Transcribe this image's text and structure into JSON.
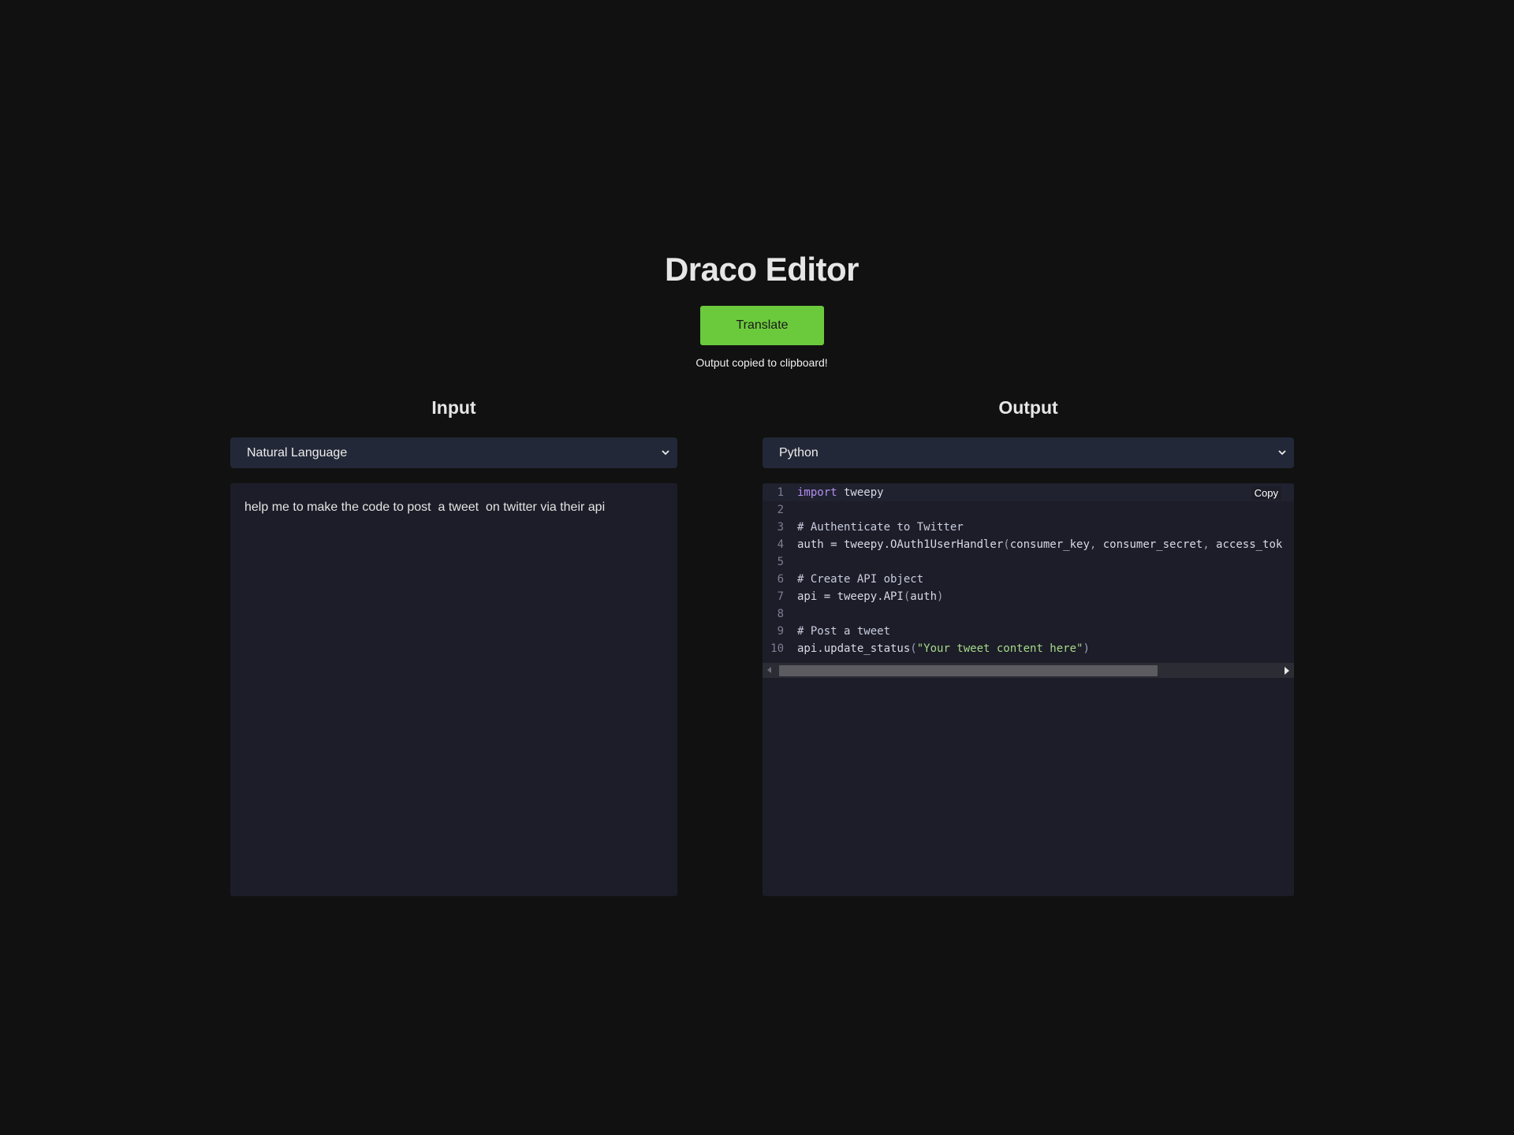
{
  "app": {
    "title": "Draco Editor"
  },
  "toolbar": {
    "translate_label": "Translate",
    "status_message": "Output copied to clipboard!"
  },
  "input": {
    "heading": "Input",
    "language_selected": "Natural Language",
    "text": "help me to make the code to post  a tweet  on twitter via their api"
  },
  "output": {
    "heading": "Output",
    "language_selected": "Python",
    "copy_label": "Copy",
    "scrollbar_position": 0.0,
    "code_lines": [
      {
        "n": "1",
        "parts": [
          [
            "kw",
            "import"
          ],
          [
            "tx",
            " tweepy"
          ]
        ]
      },
      {
        "n": "2",
        "parts": []
      },
      {
        "n": "3",
        "parts": [
          [
            "cm",
            "# Authenticate to Twitter"
          ]
        ]
      },
      {
        "n": "4",
        "parts": [
          [
            "tx",
            "auth = tweepy.OAuth1UserHandler"
          ],
          [
            "pn",
            "("
          ],
          [
            "tx",
            "consumer_key"
          ],
          [
            "pn",
            ", "
          ],
          [
            "tx",
            "consumer_secret"
          ],
          [
            "pn",
            ", "
          ],
          [
            "tx",
            "access_tok"
          ]
        ]
      },
      {
        "n": "5",
        "parts": []
      },
      {
        "n": "6",
        "parts": [
          [
            "cm",
            "# Create API object"
          ]
        ]
      },
      {
        "n": "7",
        "parts": [
          [
            "tx",
            "api = tweepy.API"
          ],
          [
            "pn",
            "("
          ],
          [
            "tx",
            "auth"
          ],
          [
            "pn",
            ")"
          ]
        ]
      },
      {
        "n": "8",
        "parts": []
      },
      {
        "n": "9",
        "parts": [
          [
            "cm",
            "# Post a tweet"
          ]
        ]
      },
      {
        "n": "10",
        "parts": [
          [
            "tx",
            "api.update_status"
          ],
          [
            "pn",
            "("
          ],
          [
            "st",
            "\"Your tweet content here\""
          ],
          [
            "pn",
            ")"
          ]
        ]
      }
    ]
  },
  "colors": {
    "background": "#111111",
    "accent": "#6bca3c",
    "panel": "#1c1d28",
    "select": "#232838"
  }
}
